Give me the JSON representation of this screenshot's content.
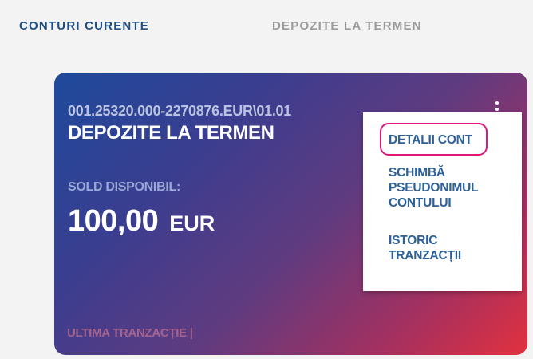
{
  "tabs": [
    {
      "label": "CONTURI CURENTE",
      "active": true
    },
    {
      "label": "DEPOZITE LA TERMEN",
      "active": false
    }
  ],
  "card": {
    "account_number": "001.25320.000-2270876.EUR\\01.01",
    "account_name": "DEPOZITE LA TERMEN",
    "balance_label": "SOLD DISPONIBIL:",
    "balance_value": "100,00",
    "currency": "EUR",
    "last_transaction": "ULTIMA TRANZACȚIE |"
  },
  "menu": {
    "items": [
      {
        "label": "DETALII CONT",
        "highlighted": true
      },
      {
        "label": "SCHIMBĂ\nPSEUDONIMUL\nCONTULUI"
      },
      {
        "label": "ISTORIC\nTRANZACȚII"
      }
    ]
  },
  "colors": {
    "tab_active": "#1f4f82",
    "tab_inactive": "#9b9b9b",
    "menu_text": "#2c6199",
    "highlight": "#e0177a",
    "card_gradient_start": "#1e4a9c",
    "card_gradient_end": "#e2313e"
  },
  "icons": {
    "card_menu": "kebab-menu-icon"
  }
}
